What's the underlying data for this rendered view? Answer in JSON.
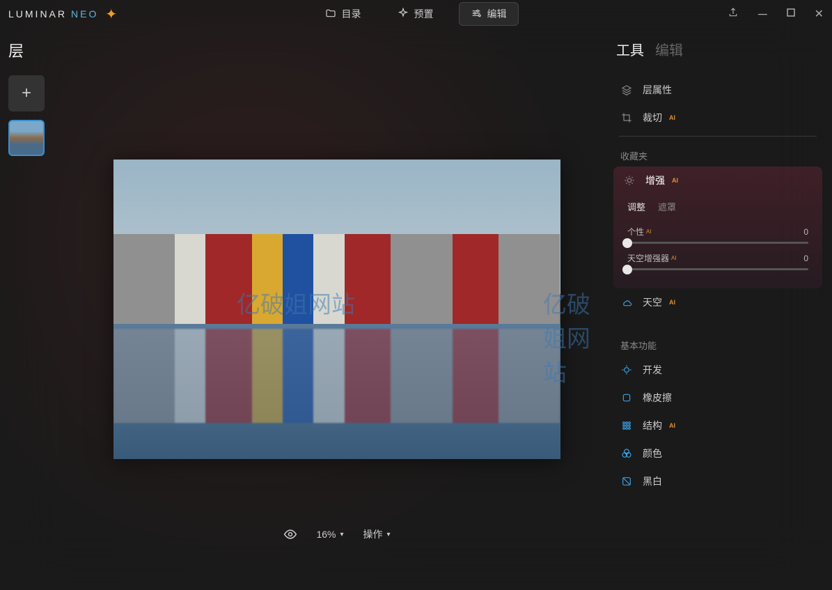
{
  "app": {
    "logo1": "LUMINAR",
    "logo2": "NEO"
  },
  "topnav": {
    "catalog": "目录",
    "presets": "预置",
    "edit": "编辑"
  },
  "layers": {
    "title": "层"
  },
  "bottom": {
    "zoom": "16%",
    "actions": "操作"
  },
  "right": {
    "tab_tools": "工具",
    "tab_edit": "编辑"
  },
  "tools": {
    "layer_props": "层属性",
    "crop": "裁切",
    "ai_badge": "AI"
  },
  "favorites": {
    "label": "收藏夹",
    "enhance": "增强",
    "sub_adjust": "调整",
    "sub_mask": "遮罩",
    "slider1_label": "个性",
    "slider1_val": "0",
    "slider2_label": "天空增强器",
    "slider2_val": "0",
    "sky": "天空"
  },
  "basics": {
    "label": "基本功能",
    "develop": "开发",
    "eraser": "橡皮擦",
    "structure": "结构",
    "color": "颜色",
    "bw": "黑白"
  },
  "watermark": "亿破姐网站"
}
